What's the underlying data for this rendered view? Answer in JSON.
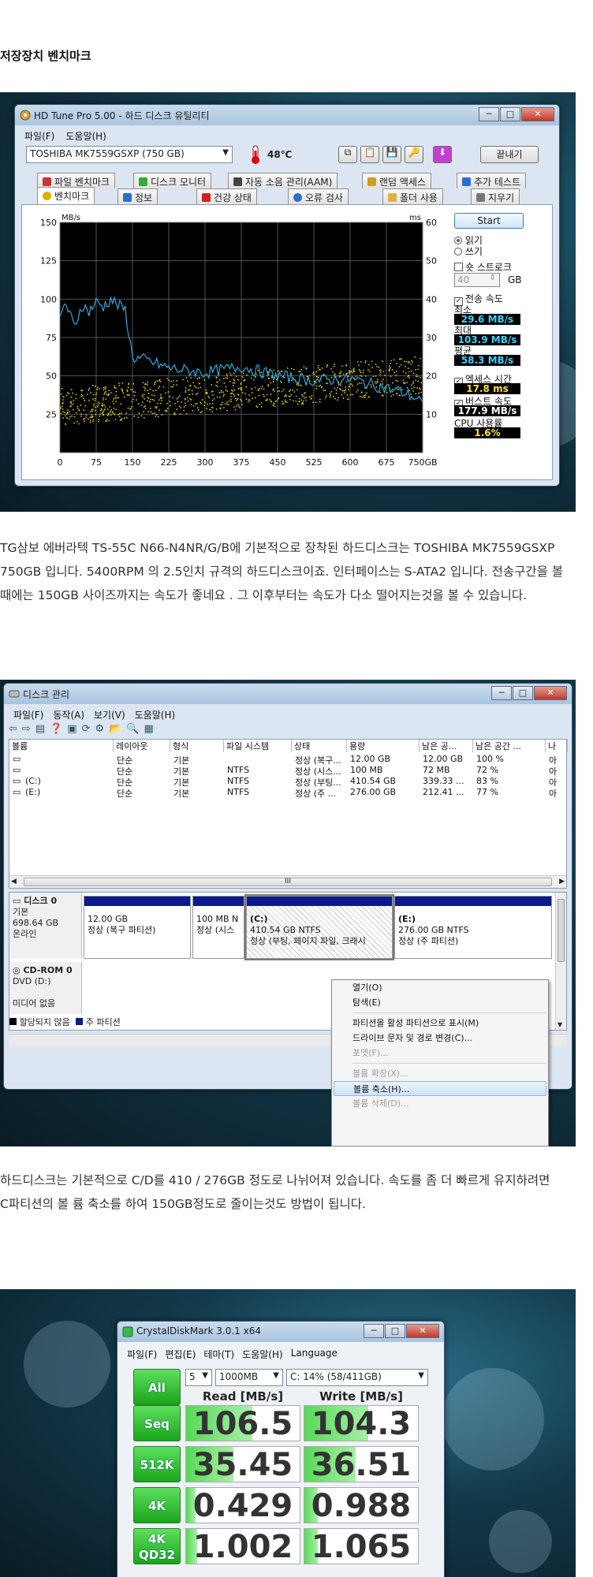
{
  "section_title": "저장장치 벤치마크",
  "hdtune": {
    "title": "HD Tune Pro 5.00 - 하드 디스크 유틸리티",
    "menu": [
      "파일(F)",
      "도움말(H)"
    ],
    "drive": "TOSHIBA MK7559GSXP     (750 GB)",
    "temperature": "48℃",
    "exit_label": "끝내기",
    "tabs_top": [
      "파일 벤치마크",
      "디스크 모니터",
      "자동 소음 관리(AAM)",
      "랜덤 액세스",
      "추가 테스트"
    ],
    "tabs_bottom": [
      "벤치마크",
      "정보",
      "건강 상태",
      "오류 검사",
      "폴더 사용",
      "지우기"
    ],
    "start_label": "Start",
    "radio_read": "읽기",
    "radio_write": "쓰기",
    "short_stroke": "숏 스트로크",
    "stroke_value": "40",
    "stroke_unit": "GB",
    "transfer_rate": "전송 속도",
    "min_label": "최소",
    "min_value": "29.6 MB/s",
    "max_label": "최대",
    "max_value": "103.9 MB/s",
    "avg_label": "평균",
    "avg_value": "58.3 MB/s",
    "access_time": "엑세스 시간",
    "access_value": "17.8 ms",
    "burst_rate": "버스트 속도",
    "burst_value": "177.9 MB/s",
    "cpu_label": "CPU 사용률",
    "cpu_value": "1.6%"
  },
  "chart_data": {
    "type": "line",
    "ylabel": "MB/s",
    "y2label": "ms",
    "xunit": "GB",
    "ylim": [
      0,
      150
    ],
    "y2lim": [
      0,
      60
    ],
    "xlim": [
      0,
      750
    ],
    "yticks": [
      25,
      50,
      75,
      100,
      125,
      150
    ],
    "y2ticks": [
      10,
      20,
      30,
      40,
      50,
      60
    ],
    "xticks": [
      "0",
      "75",
      "150",
      "225",
      "300",
      "375",
      "450",
      "525",
      "600",
      "675",
      "750GB"
    ],
    "grid": true,
    "series": [
      {
        "x": [
          0,
          10,
          20,
          30,
          45,
          60,
          75,
          90,
          105,
          120,
          135,
          150,
          180,
          225,
          300,
          375,
          450,
          525,
          600,
          675,
          720,
          750
        ],
        "values": [
          85,
          98,
          90,
          82,
          96,
          92,
          98,
          95,
          100,
          96,
          93,
          62,
          60,
          55,
          52,
          56,
          50,
          47,
          48,
          42,
          38,
          33
        ]
      }
    ],
    "scatter_ms_range": [
      10,
      24
    ]
  },
  "para1": "TG삼보 에버라텍 TS-55C N66-N4NR/G/B에 기본적으로 장착된 하드디스크는 TOSHIBA MK7559GSXP 750GB 입니다. 5400RPM 의 2.5인치 규격의 하드디스크이죠. 인터페이스는 S-ATA2 입니다. 전송구간을 볼 때에는 150GB 사이즈까지는 속도가 좋네요 . 그 이후부터는 속도가 다소 떨어지는것을 볼 수 있습니다.",
  "diskmgmt": {
    "title": "디스크 관리",
    "menu": [
      "파일(F)",
      "동작(A)",
      "보기(V)",
      "도움말(H)"
    ],
    "columns": [
      "볼륨",
      "레이아웃",
      "형식",
      "파일 시스템",
      "상태",
      "용량",
      "남은 공...",
      "남은 공간 ...",
      "나"
    ],
    "rows": [
      [
        "",
        "단순",
        "기본",
        "",
        "정상 (복구...",
        "12.00 GB",
        "12.00 GB",
        "100 %",
        "아"
      ],
      [
        "",
        "단순",
        "기본",
        "NTFS",
        "정상 (시스...",
        "100 MB",
        "72 MB",
        "72 %",
        "아"
      ],
      [
        "(C:)",
        "단순",
        "기본",
        "NTFS",
        "정상 (부팅...",
        "410.54 GB",
        "339.33 ...",
        "83 %",
        "아"
      ],
      [
        "(E:)",
        "단순",
        "기본",
        "NTFS",
        "정상 (주 ...",
        "276.00 GB",
        "212.41 ...",
        "77 %",
        "아"
      ]
    ],
    "scroll_mid": "III",
    "disk0_name": "디스크 0",
    "disk0_type": "기본",
    "disk0_size": "698.64 GB",
    "disk0_status": "온라인",
    "partitions": [
      {
        "name": "",
        "line1": "12.00 GB",
        "line2": "정상 (복구 파티션)"
      },
      {
        "name": "",
        "line1": "100 MB N",
        "line2": "정상 (시스"
      },
      {
        "name": "(C:)",
        "line1": "410.54 GB NTFS",
        "line2": "정상 (부팅, 페이지 파일, 크래시"
      },
      {
        "name": "(E:)",
        "line1": "276.00 GB NTFS",
        "line2": "정상 (주 파티션)"
      }
    ],
    "cdrom_name": "CD-ROM 0",
    "cdrom_drive": "DVD (D:)",
    "cdrom_media": "미디어 없음",
    "legend_unalloc": "할당되지 않음",
    "legend_primary": "주 파티션",
    "context_menu": [
      "열기(O)",
      "탐색(E)",
      "파티션을 활성 파티션으로 표시(M)",
      "드라이브 문자 및 경로 변경(C)...",
      "포맷(F)...",
      "볼륨 확장(X)...",
      "볼륨 축소(H)...",
      "볼륨 삭제(D)..."
    ]
  },
  "para2": "하드디스크는 기본적으로 C/D를 410 / 276GB 정도로 나뉘어져 있습니다. 속도를 좀 더 빠르게 유지하려면 C파티션의 볼 륨 축소를 하여 150GB정도로 줄이는것도 방법이 됩니다.",
  "cdm": {
    "title": "CrystalDiskMark 3.0.1 x64",
    "menu": [
      "파일(F)",
      "편집(E)",
      "테마(T)",
      "도움말(H)",
      "Language"
    ],
    "all_label": "All",
    "passes": "5",
    "size": "1000MB",
    "drive": "C: 14% (58/411GB)",
    "read_header": "Read [MB/s]",
    "write_header": "Write [MB/s]",
    "rows": [
      {
        "label": "Seq",
        "read": "106.5",
        "write": "104.3",
        "read_frac": 0.58,
        "write_frac": 0.56
      },
      {
        "label": "512K",
        "read": "35.45",
        "write": "36.51",
        "read_frac": 0.42,
        "write_frac": 0.45
      },
      {
        "label": "4K",
        "read": "0.429",
        "write": "0.988",
        "read_frac": 0.08,
        "write_frac": 0.12
      },
      {
        "label": "4K\nQD32",
        "read": "1.002",
        "write": "1.065",
        "read_frac": 0.1,
        "write_frac": 0.12
      }
    ]
  }
}
